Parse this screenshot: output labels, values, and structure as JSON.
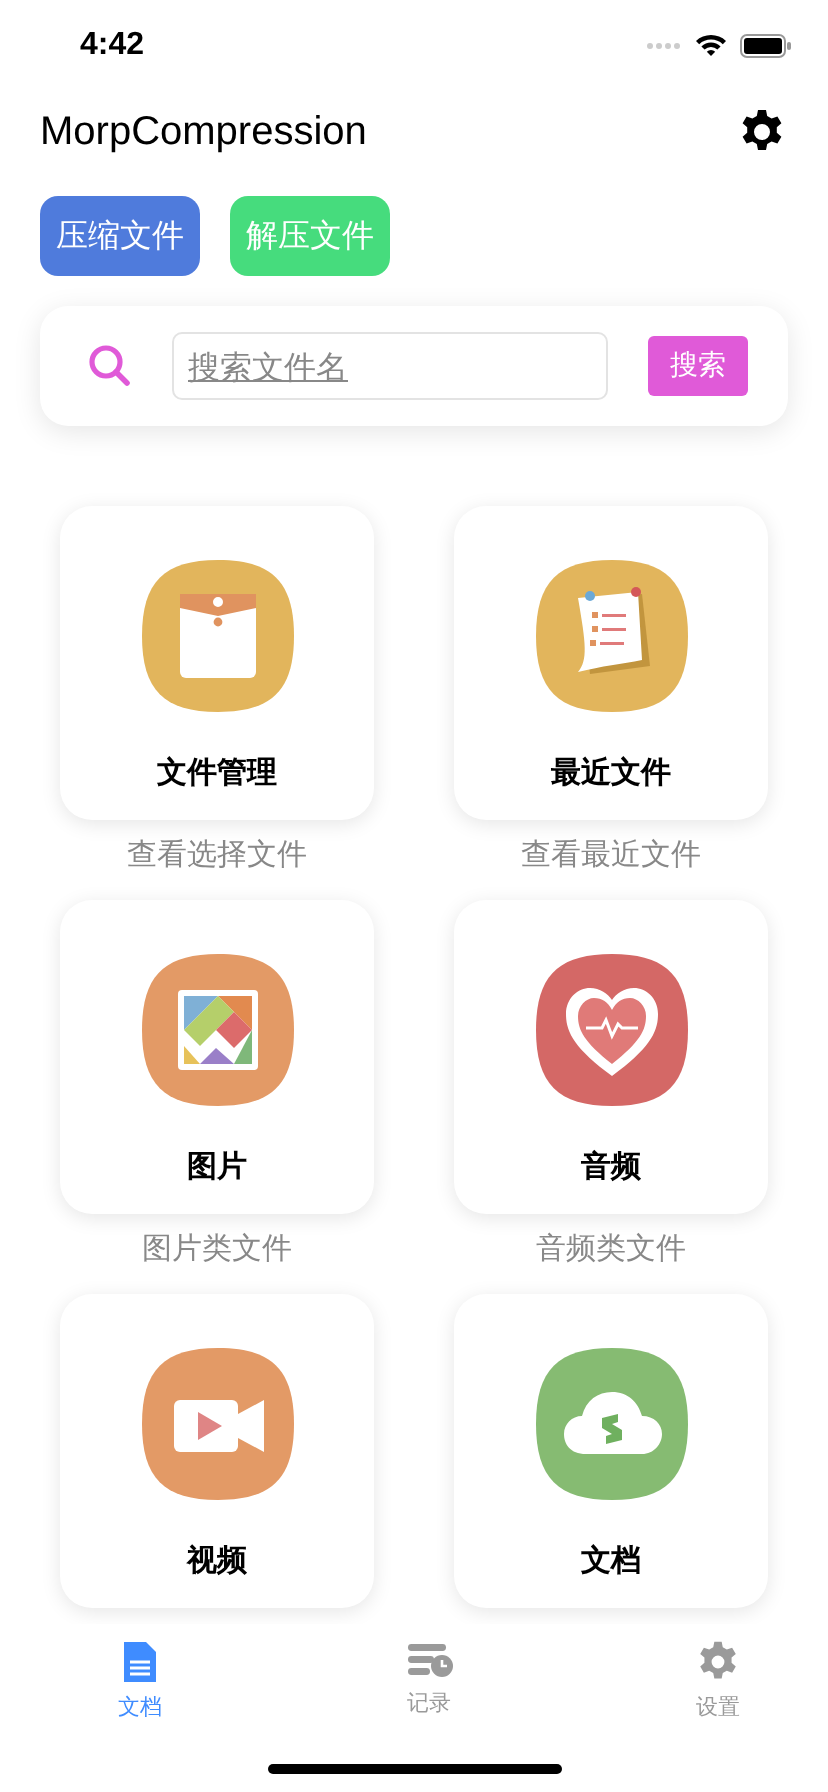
{
  "status_bar": {
    "time": "4:42"
  },
  "header": {
    "title": "MorpCompression"
  },
  "actions": [
    "压缩文件",
    "解压文件"
  ],
  "search": {
    "placeholder": "搜索文件名",
    "button": "搜索"
  },
  "categories": [
    {
      "title": "文件管理",
      "subtitle": "查看选择文件"
    },
    {
      "title": "最近文件",
      "subtitle": "查看最近文件"
    },
    {
      "title": "图片",
      "subtitle": "图片类文件"
    },
    {
      "title": "音频",
      "subtitle": "音频类文件"
    },
    {
      "title": "视频"
    },
    {
      "title": "文档"
    }
  ],
  "tab_bar": [
    {
      "label": "文档",
      "selected": true
    },
    {
      "label": "记录",
      "selected": false
    },
    {
      "label": "设置",
      "selected": false
    }
  ]
}
